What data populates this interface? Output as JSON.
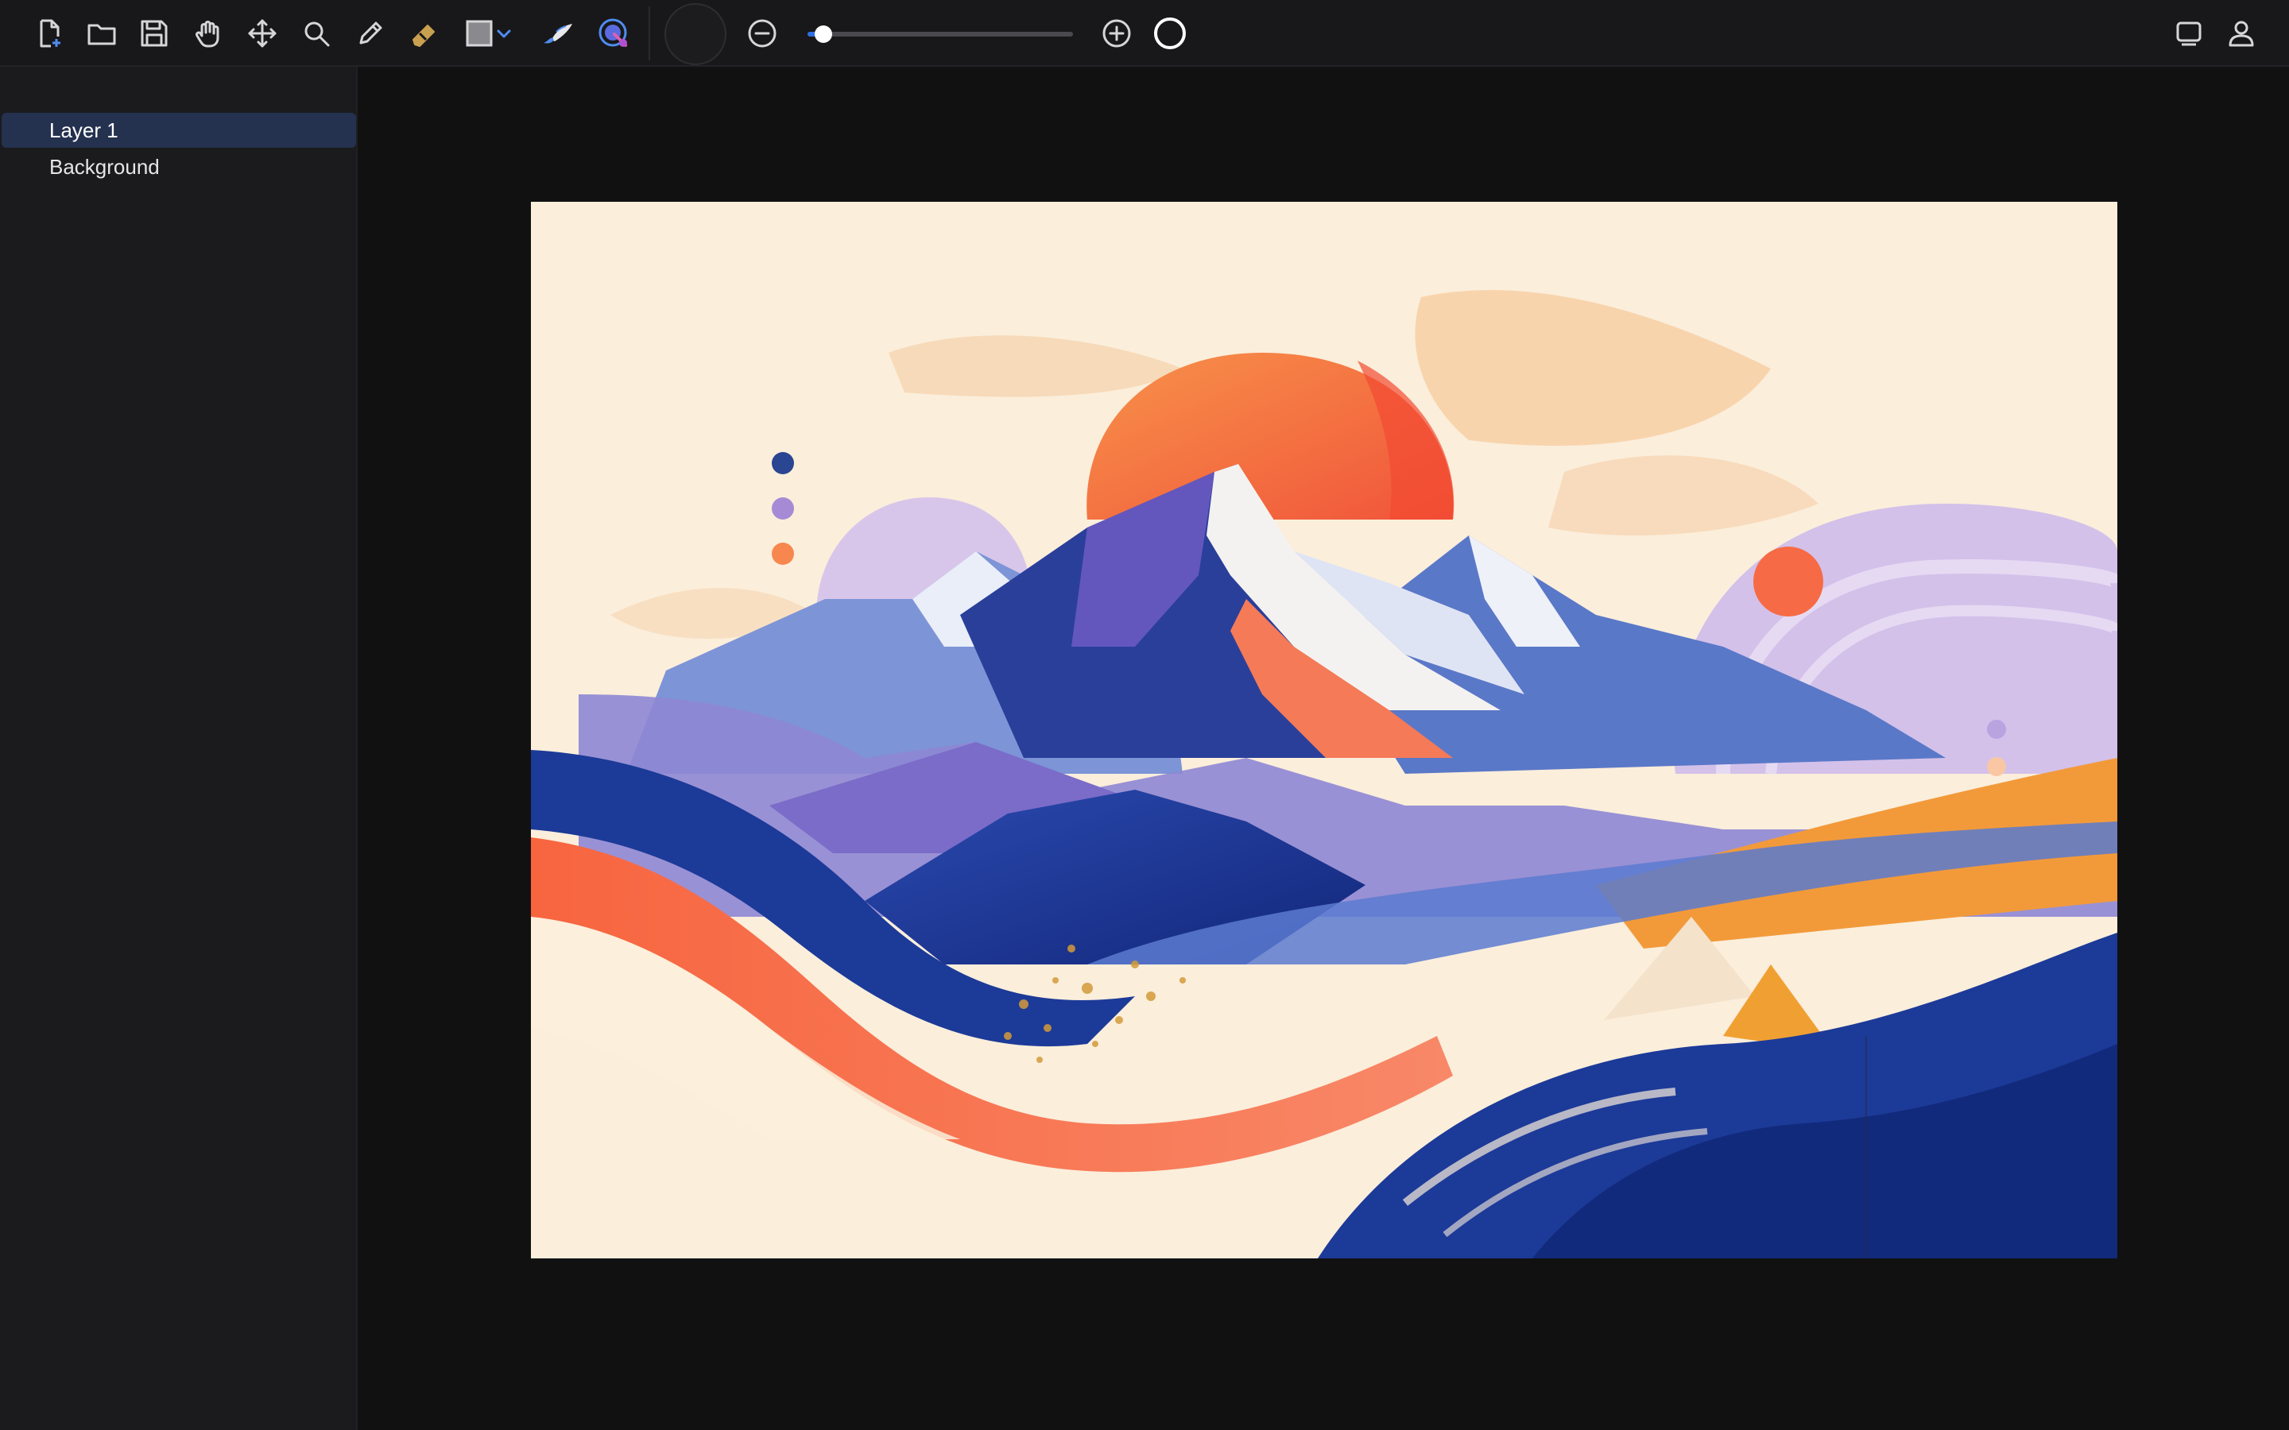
{
  "toolbar": {
    "tools": [
      {
        "name": "new-file-icon"
      },
      {
        "name": "open-folder-icon"
      },
      {
        "name": "save-icon"
      },
      {
        "name": "hand-icon"
      },
      {
        "name": "move-icon"
      },
      {
        "name": "zoom-icon"
      },
      {
        "name": "pencil-icon"
      },
      {
        "name": "eraser-icon"
      },
      {
        "name": "shape-icon"
      },
      {
        "name": "brush-icon"
      },
      {
        "name": "color-picker-icon"
      }
    ],
    "brush_size": {
      "value": 0.06,
      "decrease_icon": "minus-circle-icon",
      "increase_icon": "plus-circle-icon"
    },
    "right_icons": [
      "display-icon",
      "user-icon"
    ],
    "accent_color": "#2f6fe0"
  },
  "layers": [
    {
      "label": "Layer 1",
      "active": true
    },
    {
      "label": "Background",
      "active": false
    }
  ],
  "colors": {
    "cream": "#fbeedb",
    "orange": "#f7653f",
    "navy": "#1f3a8f",
    "lavender": "#c9b6e6",
    "blue": "#5a78c8"
  }
}
